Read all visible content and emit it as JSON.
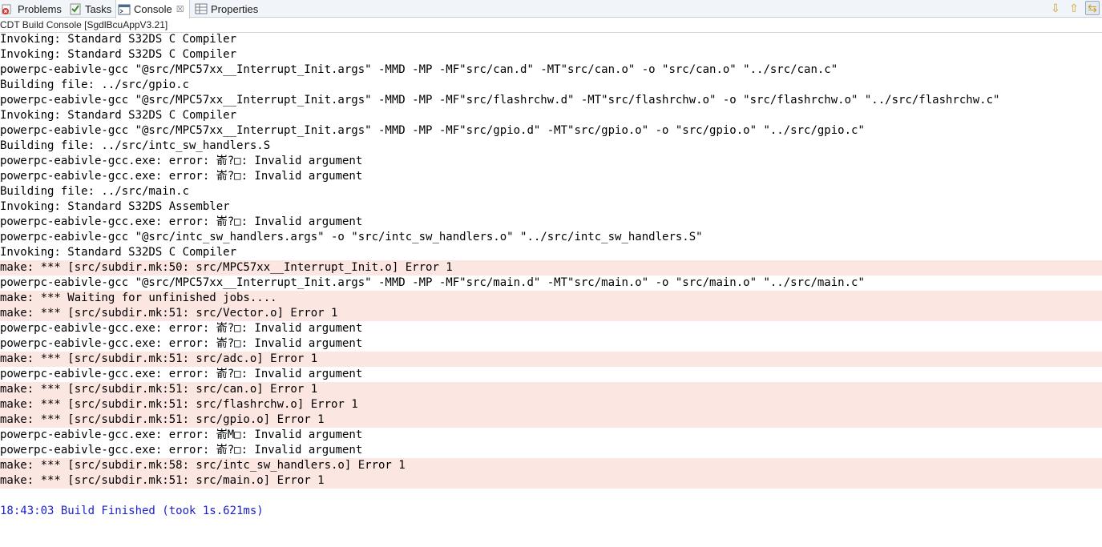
{
  "tabs": [
    {
      "label": "Problems",
      "icon": "problems-icon"
    },
    {
      "label": "Tasks",
      "icon": "tasks-icon"
    },
    {
      "label": "Console",
      "icon": "console-icon",
      "close": "☒",
      "active": true
    },
    {
      "label": "Properties",
      "icon": "properties-icon"
    }
  ],
  "toolbar": {
    "buttons": [
      {
        "name": "next-annotation-icon",
        "glyph": "⇩"
      },
      {
        "name": "previous-annotation-icon",
        "glyph": "⇧"
      },
      {
        "name": "link-with-editor-icon",
        "glyph": "⇆"
      }
    ]
  },
  "console": {
    "title": "CDT Build Console [SgdlBcuAppV3.21]",
    "lines": [
      {
        "text": "Invoking: Standard S32DS C Compiler",
        "kind": "normal"
      },
      {
        "text": "Invoking: Standard S32DS C Compiler",
        "kind": "normal"
      },
      {
        "text": "powerpc-eabivle-gcc \"@src/MPC57xx__Interrupt_Init.args\" -MMD -MP -MF\"src/can.d\" -MT\"src/can.o\" -o \"src/can.o\" \"../src/can.c\"",
        "kind": "normal"
      },
      {
        "text": "Building file: ../src/gpio.c",
        "kind": "normal"
      },
      {
        "text": "powerpc-eabivle-gcc \"@src/MPC57xx__Interrupt_Init.args\" -MMD -MP -MF\"src/flashrchw.d\" -MT\"src/flashrchw.o\" -o \"src/flashrchw.o\" \"../src/flashrchw.c\"",
        "kind": "normal"
      },
      {
        "text": "Invoking: Standard S32DS C Compiler",
        "kind": "normal"
      },
      {
        "text": "powerpc-eabivle-gcc \"@src/MPC57xx__Interrupt_Init.args\" -MMD -MP -MF\"src/gpio.d\" -MT\"src/gpio.o\" -o \"src/gpio.o\" \"../src/gpio.c\"",
        "kind": "normal"
      },
      {
        "text": "Building file: ../src/intc_sw_handlers.S",
        "kind": "normal"
      },
      {
        "text": "powerpc-eabivle-gcc.exe: error: 嵛?□: Invalid argument",
        "kind": "normal"
      },
      {
        "text": "powerpc-eabivle-gcc.exe: error: 嵛?□: Invalid argument",
        "kind": "normal"
      },
      {
        "text": "Building file: ../src/main.c",
        "kind": "normal"
      },
      {
        "text": "Invoking: Standard S32DS Assembler",
        "kind": "normal"
      },
      {
        "text": "powerpc-eabivle-gcc.exe: error: 嵛?□: Invalid argument",
        "kind": "normal"
      },
      {
        "text": "powerpc-eabivle-gcc \"@src/intc_sw_handlers.args\" -o \"src/intc_sw_handlers.o\" \"../src/intc_sw_handlers.S\"",
        "kind": "normal"
      },
      {
        "text": "Invoking: Standard S32DS C Compiler",
        "kind": "normal"
      },
      {
        "text": "make: *** [src/subdir.mk:50: src/MPC57xx__Interrupt_Init.o] Error 1",
        "kind": "err"
      },
      {
        "text": "powerpc-eabivle-gcc \"@src/MPC57xx__Interrupt_Init.args\" -MMD -MP -MF\"src/main.d\" -MT\"src/main.o\" -o \"src/main.o\" \"../src/main.c\"",
        "kind": "normal"
      },
      {
        "text": "make: *** Waiting for unfinished jobs....",
        "kind": "err"
      },
      {
        "text": "make: *** [src/subdir.mk:51: src/Vector.o] Error 1",
        "kind": "err"
      },
      {
        "text": "powerpc-eabivle-gcc.exe: error: 嵛?□: Invalid argument",
        "kind": "normal"
      },
      {
        "text": "powerpc-eabivle-gcc.exe: error: 嵛?□: Invalid argument",
        "kind": "normal"
      },
      {
        "text": "make: *** [src/subdir.mk:51: src/adc.o] Error 1",
        "kind": "err"
      },
      {
        "text": "powerpc-eabivle-gcc.exe: error: 嵛?□: Invalid argument",
        "kind": "normal"
      },
      {
        "text": "make: *** [src/subdir.mk:51: src/can.o] Error 1",
        "kind": "err"
      },
      {
        "text": "make: *** [src/subdir.mk:51: src/flashrchw.o] Error 1",
        "kind": "err"
      },
      {
        "text": "make: *** [src/subdir.mk:51: src/gpio.o] Error 1",
        "kind": "err"
      },
      {
        "text": "powerpc-eabivle-gcc.exe: error: 嵛M□: Invalid argument",
        "kind": "normal"
      },
      {
        "text": "powerpc-eabivle-gcc.exe: error: 嵛?□: Invalid argument",
        "kind": "normal"
      },
      {
        "text": "make: *** [src/subdir.mk:58: src/intc_sw_handlers.o] Error 1",
        "kind": "err"
      },
      {
        "text": "make: *** [src/subdir.mk:51: src/main.o] Error 1",
        "kind": "err"
      },
      {
        "text": "",
        "kind": "blank"
      },
      {
        "text": "18:43:03 Build Finished (took 1s.621ms)",
        "kind": "info"
      }
    ]
  },
  "colors": {
    "error_background": "#fce6e2",
    "info_text": "#1e22c8",
    "tabbar_background": "#f1f4f8"
  }
}
